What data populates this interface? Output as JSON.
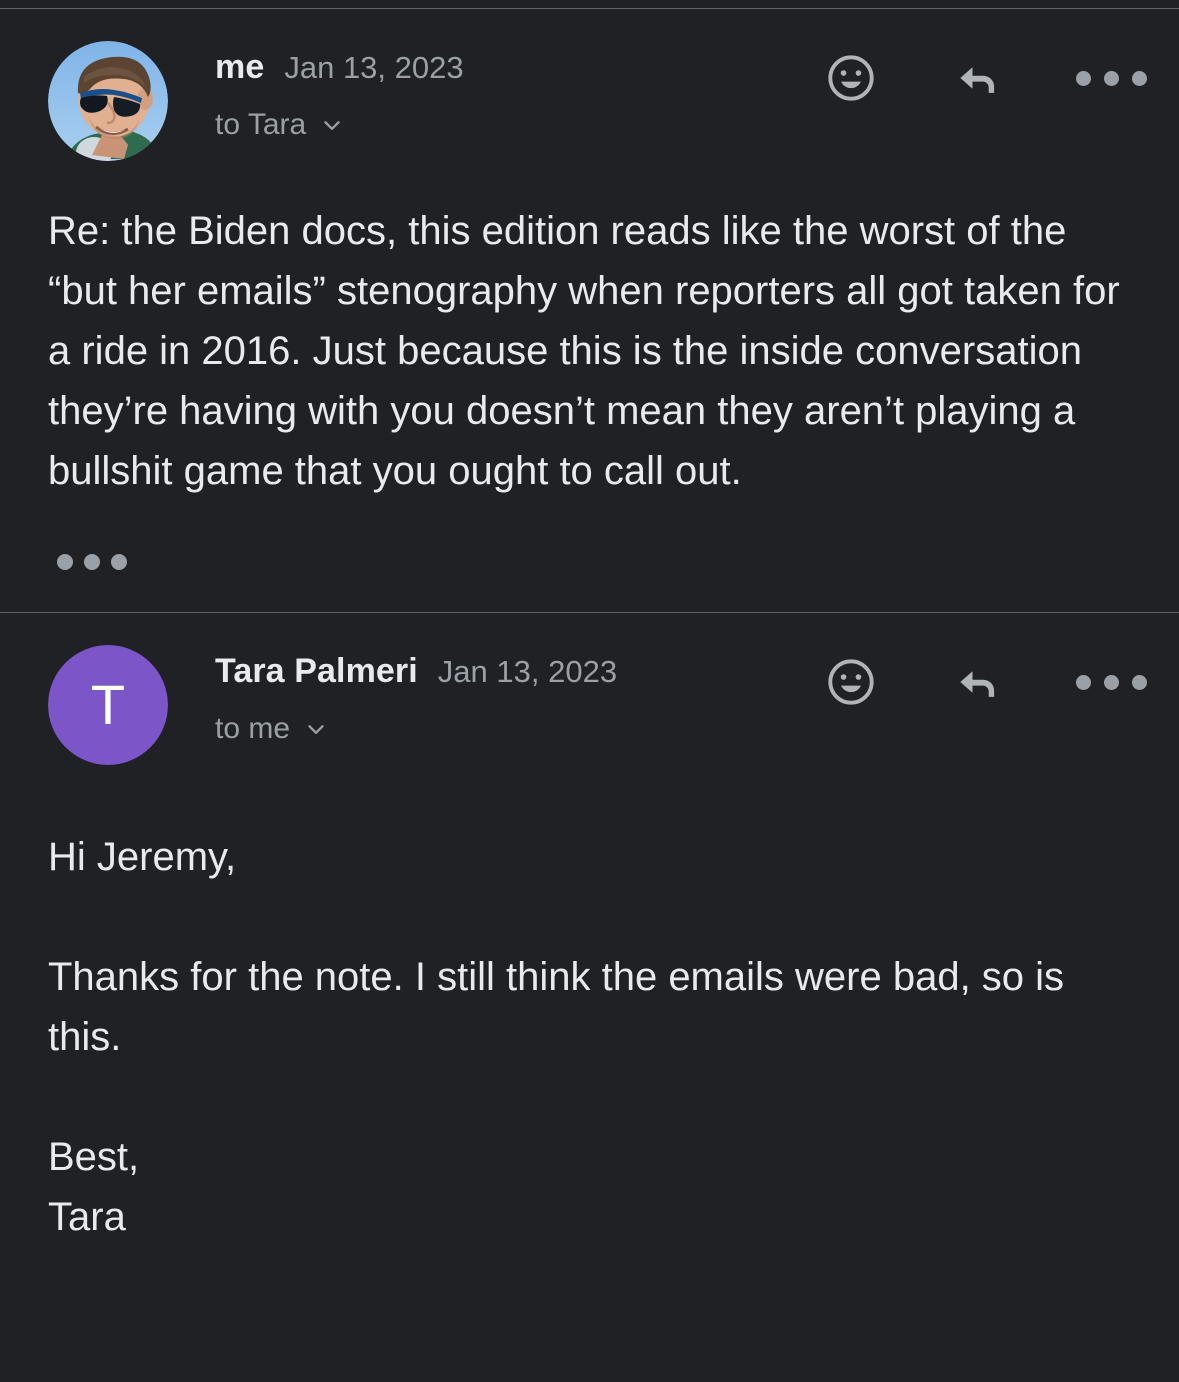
{
  "theme": {
    "background": "#202124",
    "divider": "#5f6368",
    "text_primary": "#e8eaed",
    "text_secondary": "#9aa0a6",
    "avatar_purple": "#7c55c9",
    "avatar_letter_color": "#ffffff"
  },
  "messages": [
    {
      "sender": "me",
      "date": "Jan 13, 2023",
      "recipient": "to Tara",
      "avatar": {
        "type": "photo",
        "name": "profile-photo-me",
        "description": "photo of a smiling man wearing blue sunglasses against a blue sky"
      },
      "body": "Re: the Biden docs, this edition reads like the worst of the “but her emails” stenography when reporters all got taken for a ride in 2016. Just because this is the inside conversation they’re having with you doesn’t mean they aren’t playing a bullshit game that you ought to call out.",
      "has_trimmed_content": true,
      "actions": {
        "react": "add-reaction",
        "reply": "reply",
        "more": "more-options"
      }
    },
    {
      "sender": "Tara Palmeri",
      "date": "Jan 13, 2023",
      "recipient": "to me",
      "avatar": {
        "type": "letter",
        "name": "avatar-initial-tara",
        "letter": "T",
        "color": "#7c55c9"
      },
      "body": "Hi Jeremy,\n\nThanks for the note. I still think the emails were bad, so is this.\n\nBest,\nTara",
      "has_trimmed_content": false,
      "actions": {
        "react": "add-reaction",
        "reply": "reply",
        "more": "more-options"
      }
    }
  ]
}
